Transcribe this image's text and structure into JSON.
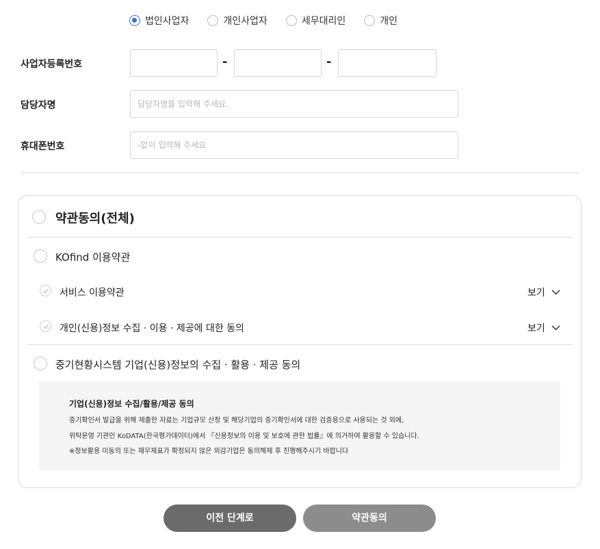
{
  "member_types": {
    "options": [
      "법인사업자",
      "개인사업자",
      "세무대리인",
      "개인"
    ],
    "selected": "법인사업자"
  },
  "form": {
    "business_no_label": "사업자등록번호",
    "dash": "-",
    "manager_label": "담당자명",
    "manager_placeholder": "담당자명을 입력해 주세요.",
    "phone_label": "휴대폰번호",
    "phone_placeholder": "-없이 입력해 주세요"
  },
  "terms": {
    "all_label": "약관동의(전체)",
    "kofind_label": "KOfind 이용약관",
    "service_label": "서비스 이용약관",
    "privacy_label": "개인(신용)정보 수집 · 이용 · 제공에 대한 동의",
    "view_label": "보기",
    "corp_label": "중기현황시스템 기업(신용)정보의 수집 · 활용 · 제공 동의"
  },
  "notice": {
    "title": "기업(신용)정보 수집/활용/제공 동의",
    "lines": [
      "중기확인서 발급을 위해 제출한 자료는 기업규모 산정 및 해당기업의 중기확인서에 대한 검증용으로 사용되는 것 외에,",
      "위탁운영 기관인 KoDATA(한국평가데이터)에서 『신용정보의 이용 및 보호에 관한 법률』에 의거하여 활용할 수 있습니다.",
      "※정보활용 미동의 또는 재무제표가 확정되지 않은 외감기업은 동의해제 후 진행해주시기 바랍니다"
    ]
  },
  "buttons": {
    "prev": "이전 단계로",
    "agree": "약관동의"
  },
  "colors": {
    "accent": "#3b6fe0",
    "prev_button": "#6b6b6b",
    "agree_button": "#8c8c8c"
  }
}
